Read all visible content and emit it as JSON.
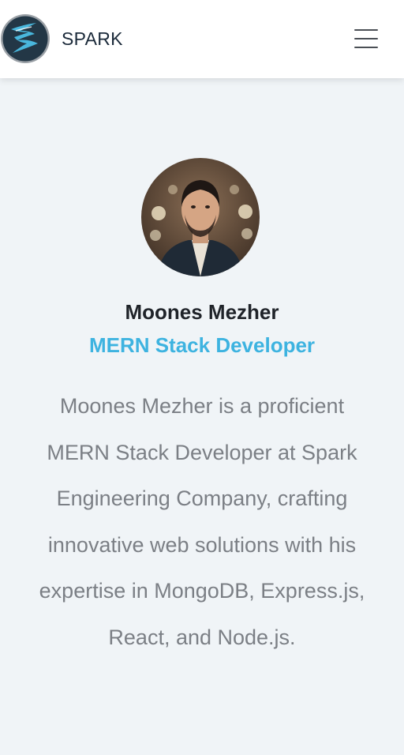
{
  "navbar": {
    "brand": "SPARK",
    "logo_icon": "spark-logo-icon",
    "menu_icon": "hamburger-menu-icon"
  },
  "profile": {
    "avatar_icon": "profile-photo",
    "name": "Moones Mezher",
    "role": "MERN Stack Developer",
    "bio": "Moones Mezher is a proficient MERN Stack Developer at Spark Engineering Company, crafting innovative web solutions with his expertise in MongoDB, Express.js, React, and Node.js."
  },
  "colors": {
    "accent": "#3db3e0",
    "background": "#f0f4f7",
    "name_text": "#1f2329",
    "body_text": "#7b7f85"
  }
}
